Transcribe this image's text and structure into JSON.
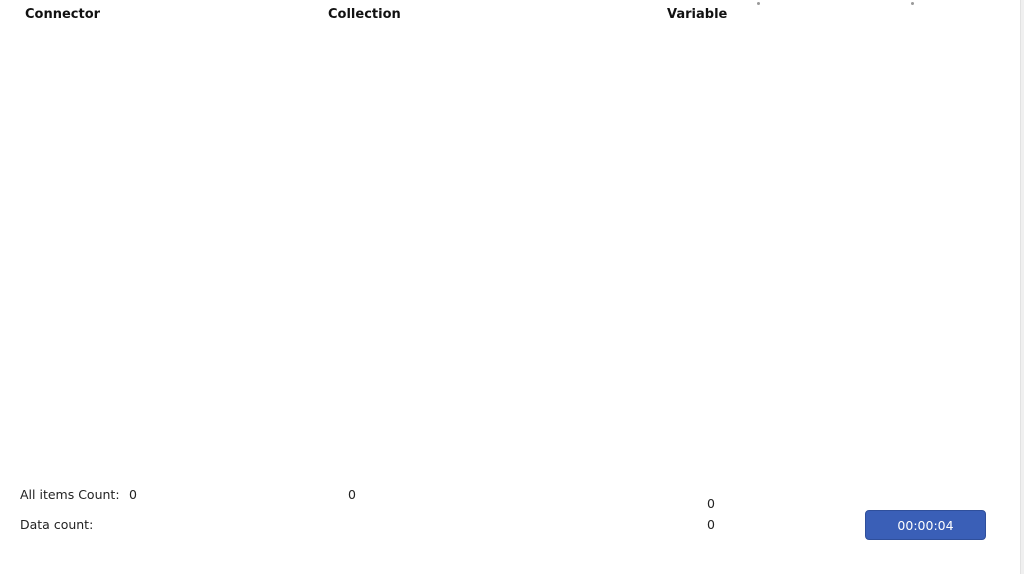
{
  "headers": {
    "connector": "Connector",
    "collection": "Collection",
    "variable": "Variable"
  },
  "footer": {
    "all_items_label": "All items Count:",
    "all_items_value": "0",
    "collection_value": "0",
    "variable_value_top": "0",
    "data_count_label": "Data count:",
    "variable_value_bottom": "0"
  },
  "timer": {
    "label": "00:00:04"
  },
  "colors": {
    "timer_button": "#3a5fb7",
    "text": "#222222",
    "background": "#ffffff"
  }
}
